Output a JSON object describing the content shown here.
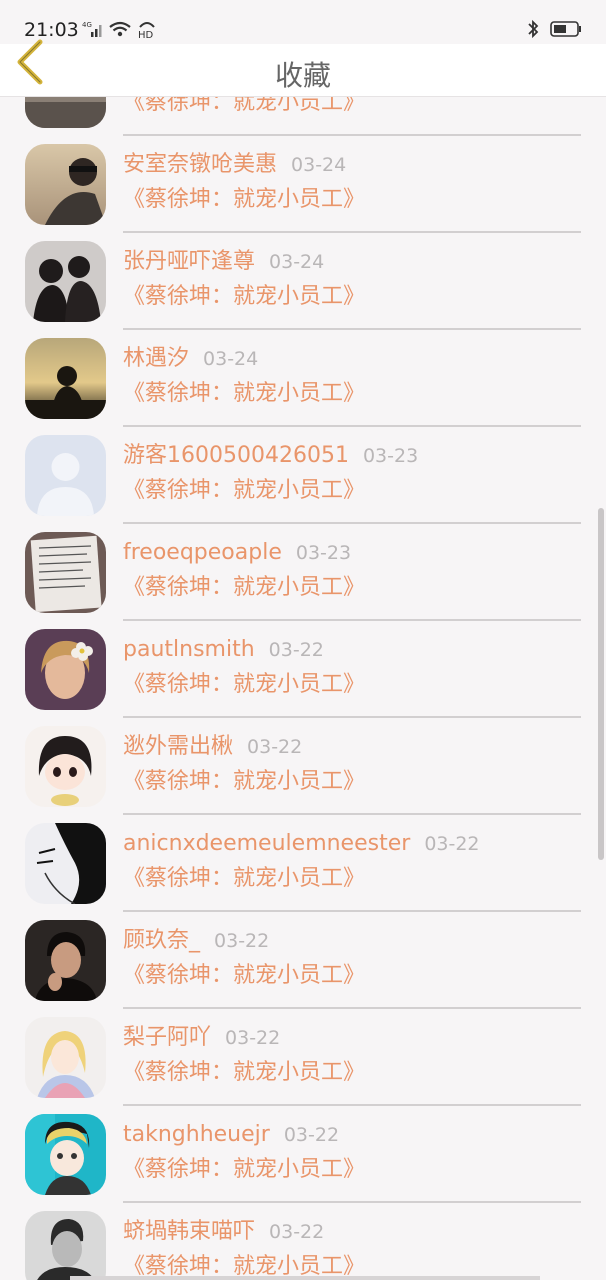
{
  "status_bar": {
    "time": "21:03",
    "network": "4G",
    "wifi_label": "HD",
    "battery_icon": "battery-icon",
    "bluetooth_icon": "bluetooth-icon"
  },
  "header": {
    "title": "收藏",
    "back_icon": "chevron-left-icon"
  },
  "colors": {
    "accent": "#e9956a",
    "back_arrow": "#d4b43c",
    "date": "#b9b6b7",
    "background": "#f7f5f6"
  },
  "items": [
    {
      "name": "",
      "date": "",
      "book": "《蔡徐坤：就宠小员工》",
      "avatar": "partial"
    },
    {
      "name": "安室奈镦呛美惠",
      "date": "03-24",
      "book": "《蔡徐坤：就宠小员工》",
      "avatar": "photo-beach"
    },
    {
      "name": "张丹哑吓逢尊",
      "date": "03-24",
      "book": "《蔡徐坤：就宠小员工》",
      "avatar": "photo-couple"
    },
    {
      "name": "林遇汐",
      "date": "03-24",
      "book": "《蔡徐坤：就宠小员工》",
      "avatar": "photo-sunset"
    },
    {
      "name": "游客1600500426051",
      "date": "03-23",
      "book": "《蔡徐坤：就宠小员工》",
      "avatar": "default-user"
    },
    {
      "name": "freoeqpeoaple",
      "date": "03-23",
      "book": "《蔡徐坤：就宠小员工》",
      "avatar": "photo-notebook"
    },
    {
      "name": "pautlnsmith",
      "date": "03-22",
      "book": "《蔡徐坤：就宠小员工》",
      "avatar": "photo-girl-flower"
    },
    {
      "name": "逖外需出楸",
      "date": "03-22",
      "book": "《蔡徐坤：就宠小员工》",
      "avatar": "anime-girl"
    },
    {
      "name": "anicnxdeemeulemneester",
      "date": "03-22",
      "book": "《蔡徐坤：就宠小员工》",
      "avatar": "sketch-man"
    },
    {
      "name": "顾玖奈_",
      "date": "03-22",
      "book": "《蔡徐坤：就宠小员工》",
      "avatar": "photo-man"
    },
    {
      "name": "梨子阿吖",
      "date": "03-22",
      "book": "《蔡徐坤：就宠小员工》",
      "avatar": "anime-blonde"
    },
    {
      "name": "taknghheuejr",
      "date": "03-22",
      "book": "《蔡徐坤：就宠小员工》",
      "avatar": "anime-boy"
    },
    {
      "name": "蛴堝韩束喵吓",
      "date": "03-22",
      "book": "《蔡徐坤：就宠小员工》",
      "avatar": "photo-bw-man"
    }
  ]
}
